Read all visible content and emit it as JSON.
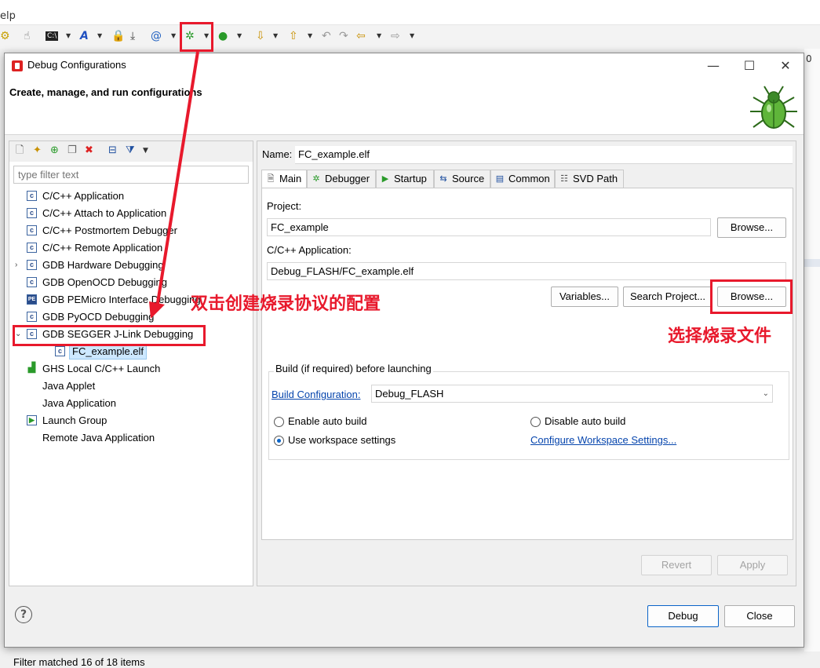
{
  "ide": {
    "menu_help_fragment": "elp",
    "right_edge_text": "0"
  },
  "dialog": {
    "title": "Debug Configurations",
    "header_text": "Create, manage, and run configurations",
    "window_controls": {
      "minimize": "—",
      "maximize": "☐",
      "close": "✕"
    }
  },
  "left_panel": {
    "toolbar_icons": [
      "new-config-icon",
      "new-prototype-icon",
      "export-icon",
      "duplicate-icon",
      "delete-icon",
      "collapse-all-icon",
      "filter-icon",
      "view-menu-icon"
    ],
    "filter_placeholder": "type filter text",
    "tree": [
      {
        "label": "C/C++ Application",
        "icon": "c",
        "level": 0
      },
      {
        "label": "C/C++ Attach to Application",
        "icon": "c",
        "level": 0
      },
      {
        "label": "C/C++ Postmortem Debugger",
        "icon": "c",
        "level": 0
      },
      {
        "label": "C/C++ Remote Application",
        "icon": "c",
        "level": 0
      },
      {
        "label": "GDB Hardware Debugging",
        "icon": "c",
        "level": 0,
        "expander": "›"
      },
      {
        "label": "GDB OpenOCD Debugging",
        "icon": "c",
        "level": 0
      },
      {
        "label": "GDB PEMicro Interface Debugging",
        "icon": "pe",
        "level": 0
      },
      {
        "label": "GDB PyOCD Debugging",
        "icon": "c",
        "level": 0
      },
      {
        "label": "GDB SEGGER J-Link Debugging",
        "icon": "c",
        "level": 0,
        "expander": "⌄"
      },
      {
        "label": "FC_example.elf",
        "icon": "c",
        "level": 1,
        "selected": true
      },
      {
        "label": "GHS Local C/C++ Launch",
        "icon": "ghs",
        "level": 0
      },
      {
        "label": "Java Applet",
        "icon": "none",
        "level": 0
      },
      {
        "label": "Java Application",
        "icon": "none",
        "level": 0
      },
      {
        "label": "Launch Group",
        "icon": "group",
        "level": 0
      },
      {
        "label": "Remote Java Application",
        "icon": "none",
        "level": 0
      }
    ],
    "status": "Filter matched 16 of 18 items"
  },
  "right_panel": {
    "name_label": "Name:",
    "name_value": "FC_example.elf",
    "tabs": [
      {
        "label": "Main",
        "icon": "main-tab-icon"
      },
      {
        "label": "Debugger",
        "icon": "debugger-tab-icon"
      },
      {
        "label": "Startup",
        "icon": "startup-tab-icon"
      },
      {
        "label": "Source",
        "icon": "source-tab-icon"
      },
      {
        "label": "Common",
        "icon": "common-tab-icon"
      },
      {
        "label": "SVD Path",
        "icon": "svd-tab-icon"
      }
    ],
    "project_label": "Project:",
    "project_value": "FC_example",
    "browse_label": "Browse...",
    "app_label": "C/C++ Application:",
    "app_value": "Debug_FLASH/FC_example.elf",
    "variables_label": "Variables...",
    "search_project_label": "Search Project...",
    "build_group_label": "Build (if required) before launching",
    "build_config_link": "Build Configuration:",
    "build_config_value": "Debug_FLASH",
    "enable_auto_build": "Enable auto build",
    "disable_auto_build": "Disable auto build",
    "use_workspace": "Use workspace settings",
    "configure_workspace_link": "Configure Workspace Settings...",
    "revert_label": "Revert",
    "apply_label": "Apply"
  },
  "footer": {
    "help_label": "?",
    "debug_label": "Debug",
    "close_label": "Close"
  },
  "annotations": {
    "double_click_note": "双击创建烧录协议的配置",
    "select_file_note": "选择烧录文件",
    "color": "#e8192c"
  }
}
